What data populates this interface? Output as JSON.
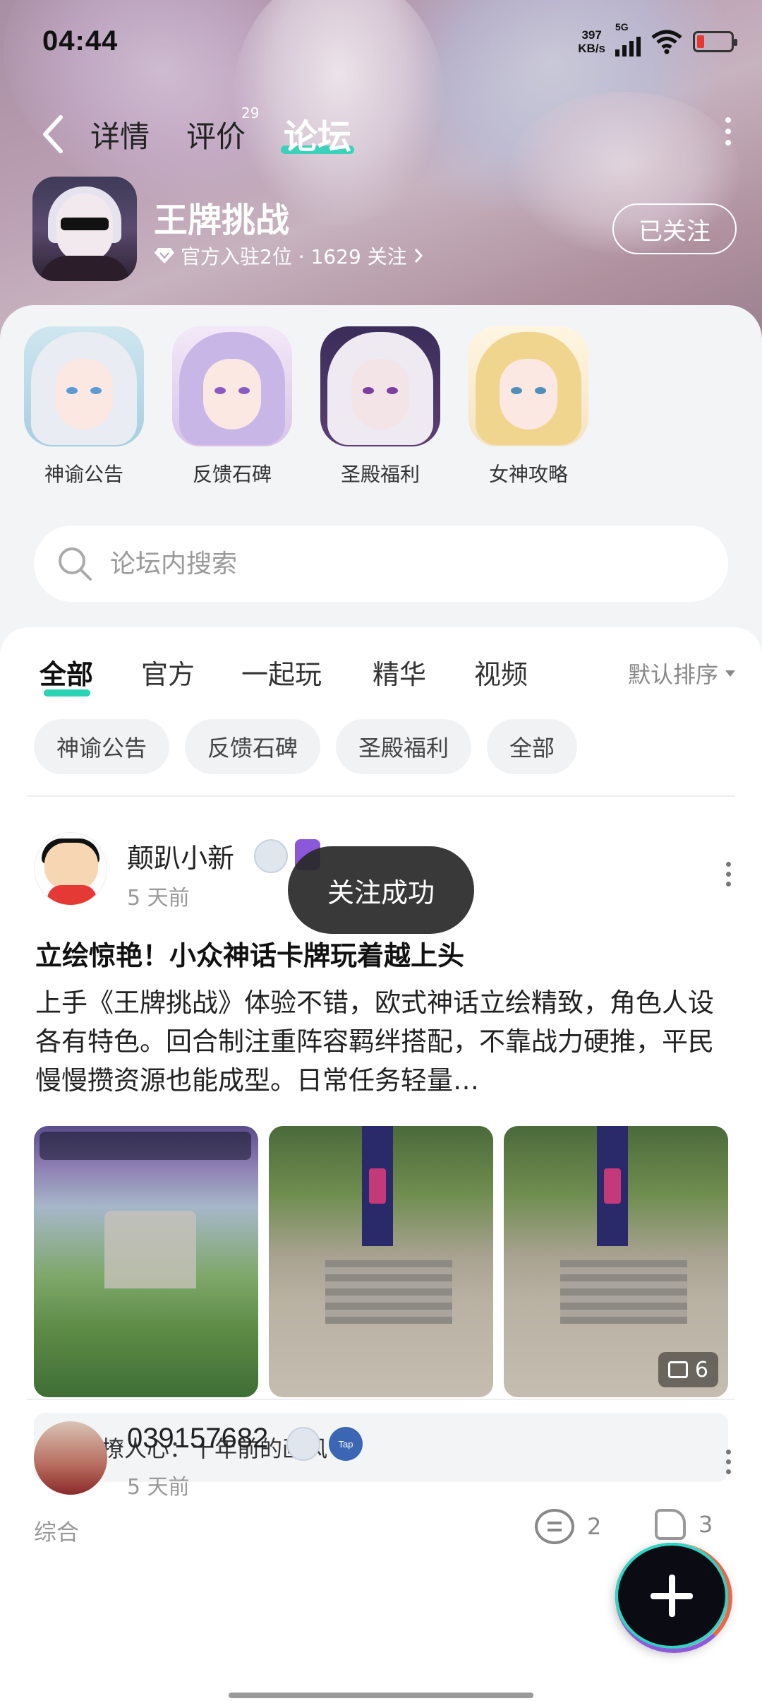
{
  "status_bar": {
    "time": "04:44",
    "net_speed": "397",
    "net_unit": "KB/s",
    "network": "5G"
  },
  "nav": {
    "tabs": [
      {
        "label": "详情"
      },
      {
        "label": "评价",
        "badge": "29"
      },
      {
        "label": "论坛",
        "active": true
      }
    ]
  },
  "game": {
    "title": "王牌挑战",
    "subtitle": "官方入驻2位 · 1629 关注",
    "follow_label": "已关注"
  },
  "categories": [
    {
      "label": "神谕公告"
    },
    {
      "label": "反馈石碑"
    },
    {
      "label": "圣殿福利"
    },
    {
      "label": "女神攻略"
    }
  ],
  "search": {
    "placeholder": "论坛内搜索"
  },
  "feed_tabs": {
    "items": [
      "全部",
      "官方",
      "一起玩",
      "精华",
      "视频"
    ],
    "active": "全部",
    "sort_label": "默认排序"
  },
  "chips": [
    "神谕公告",
    "反馈石碑",
    "圣殿福利",
    "全部"
  ],
  "post1": {
    "author": "颠趴小新",
    "time": "5 天前",
    "title": "立绘惊艳！小众神话卡牌玩着越上头",
    "body": "上手《王牌挑战》体验不错，欧式神话立绘精致，角色人设各有特色。回合制注重阵容羁绊搭配，不靠战力硬推，平民慢慢攒资源也能成型。日常任务轻量…",
    "image_count": "6",
    "quote": "套路撩人心：十年前的画风",
    "tag": "综合",
    "comments": "2",
    "likes": "3"
  },
  "post2": {
    "author": "039157682",
    "time": "5 天前",
    "badge_text": "Tap"
  },
  "toast": "关注成功",
  "colors": {
    "accent": "#2ad3b6",
    "toast_bg": "#282828"
  }
}
